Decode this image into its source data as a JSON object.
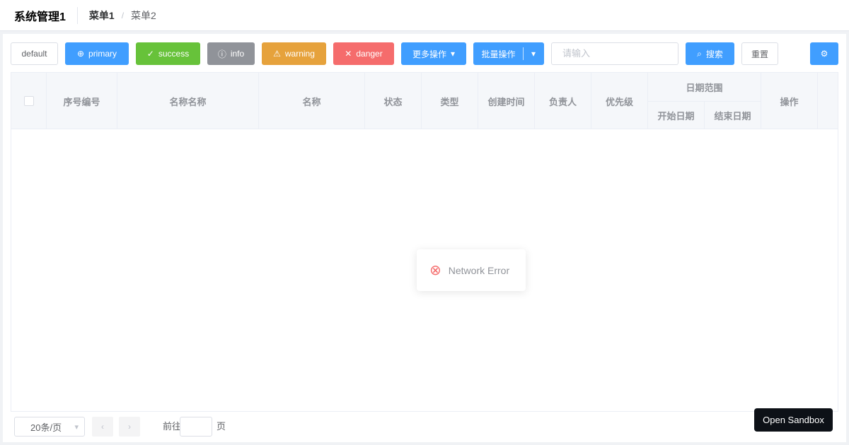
{
  "header": {
    "title": "系统管理1",
    "breadcrumb": [
      "菜单1",
      "菜单2"
    ],
    "separator": "/"
  },
  "toolbar": {
    "default_label": "default",
    "primary_label": "primary",
    "success_label": "success",
    "info_label": "info",
    "warning_label": "warning",
    "danger_label": "danger",
    "dropdown_label": "更多操作",
    "split_label": "批量操作",
    "search_placeholder": "请输入",
    "search_label": "搜索",
    "reset_label": "重置",
    "icon_glyph": "⊕"
  },
  "table": {
    "columns": [
      "序号编号",
      "名称名称",
      "名称",
      "状态",
      "类型",
      "创建时间",
      "负责人",
      "优先级",
      "日期范围",
      "操作"
    ],
    "subcolumns": [
      "开始日期",
      "结束日期"
    ],
    "rows": []
  },
  "error": {
    "message": "Network Error",
    "icon": "error-icon"
  },
  "pagination": {
    "page_size": "20条/页",
    "prev": "‹",
    "next": "›",
    "goto_label": "前往",
    "page_unit": "页"
  },
  "sandbox": {
    "label": "Open Sandbox"
  },
  "colors": {
    "primary": "#409eff",
    "success": "#67c23a",
    "info": "#909399",
    "warning": "#e6a23c",
    "danger": "#f56c6c"
  }
}
